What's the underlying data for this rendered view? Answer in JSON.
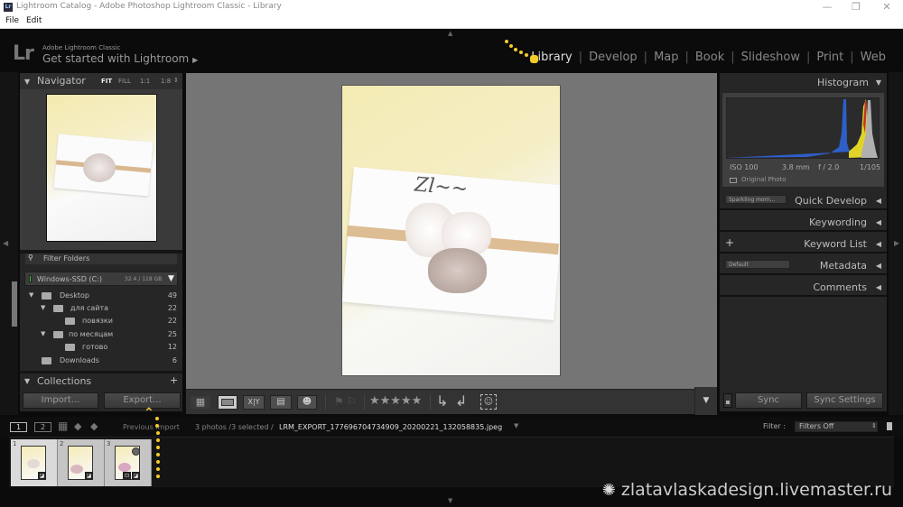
{
  "window": {
    "app_icon": "Lr",
    "title": "Lightroom Catalog - Adobe Photoshop Lightroom Classic - Library",
    "controls": {
      "minimize": "—",
      "restore": "❐",
      "close": "✕"
    }
  },
  "menu": [
    "File",
    "Edit"
  ],
  "header": {
    "logo": "Lr",
    "product": "Adobe Lightroom Classic",
    "tagline": "Get started with Lightroom",
    "tagline_arrow": "▶",
    "modules": [
      "Library",
      "Develop",
      "Map",
      "Book",
      "Slideshow",
      "Print",
      "Web"
    ],
    "active_module": "Library",
    "separator": "|"
  },
  "navigator": {
    "title": "Navigator",
    "zoom_options": [
      "FIT",
      "FILL",
      "1:1",
      "1:8"
    ],
    "active_zoom": "FIT"
  },
  "folders": {
    "filter_placeholder": "Filter Folders",
    "volume": {
      "name": "Windows-SSD (C:)",
      "usage": "32.4 / 118 GB"
    },
    "tree": [
      {
        "name": "Desktop",
        "count": "49",
        "level": 0,
        "expanded": true
      },
      {
        "name": "для сайта",
        "count": "22",
        "level": 1,
        "expanded": true
      },
      {
        "name": "повязки",
        "count": "22",
        "level": 2,
        "expanded": false
      },
      {
        "name": "по месяцам",
        "count": "25",
        "level": 1,
        "expanded": true
      },
      {
        "name": "готово",
        "count": "12",
        "level": 2,
        "expanded": false
      },
      {
        "name": "Downloads",
        "count": "6",
        "level": 0,
        "expanded": false
      }
    ]
  },
  "collections": {
    "title": "Collections",
    "add": "+"
  },
  "left_buttons": {
    "import": "Import...",
    "export": "Export..."
  },
  "histogram": {
    "title": "Histogram",
    "iso": "ISO 100",
    "focal": "3.8 mm",
    "aperture": "f / 2.0",
    "shutter": "1/105",
    "original_photo": "Original Photo"
  },
  "right_panels": {
    "quick_develop": {
      "label": "Quick Develop",
      "preset": "Sparkling morn..."
    },
    "keywording": {
      "label": "Keywording"
    },
    "keyword_list": {
      "label": "Keyword List",
      "add": "+"
    },
    "metadata": {
      "label": "Metadata",
      "preset": "Default"
    },
    "comments": {
      "label": "Comments"
    }
  },
  "right_buttons": {
    "sync": "Sync",
    "sync_settings": "Sync Settings"
  },
  "toolbar": {
    "views": [
      "grid-view",
      "loupe-view",
      "compare-view",
      "survey-view",
      "people-view"
    ],
    "compare_label": "X|Y",
    "stars": "★★★★★",
    "rating": 0
  },
  "filmstrip_bar": {
    "screens": [
      "1",
      "2"
    ],
    "source": "Previous Import",
    "selection": "3 photos /3 selected /",
    "filename": "LRM_EXPORT_177696704734909_20200221_132058835.jpeg",
    "filter_label": "Filter :",
    "filter_value": "Filters Off"
  },
  "filmstrip": [
    {
      "index": "1"
    },
    {
      "index": "2"
    },
    {
      "index": "3"
    }
  ],
  "watermark": "zlatavlaskadesign.livemaster.ru",
  "colors": {
    "accent_annotation": "#f2cc29",
    "panel": "#262626",
    "center_bg": "#757575"
  }
}
